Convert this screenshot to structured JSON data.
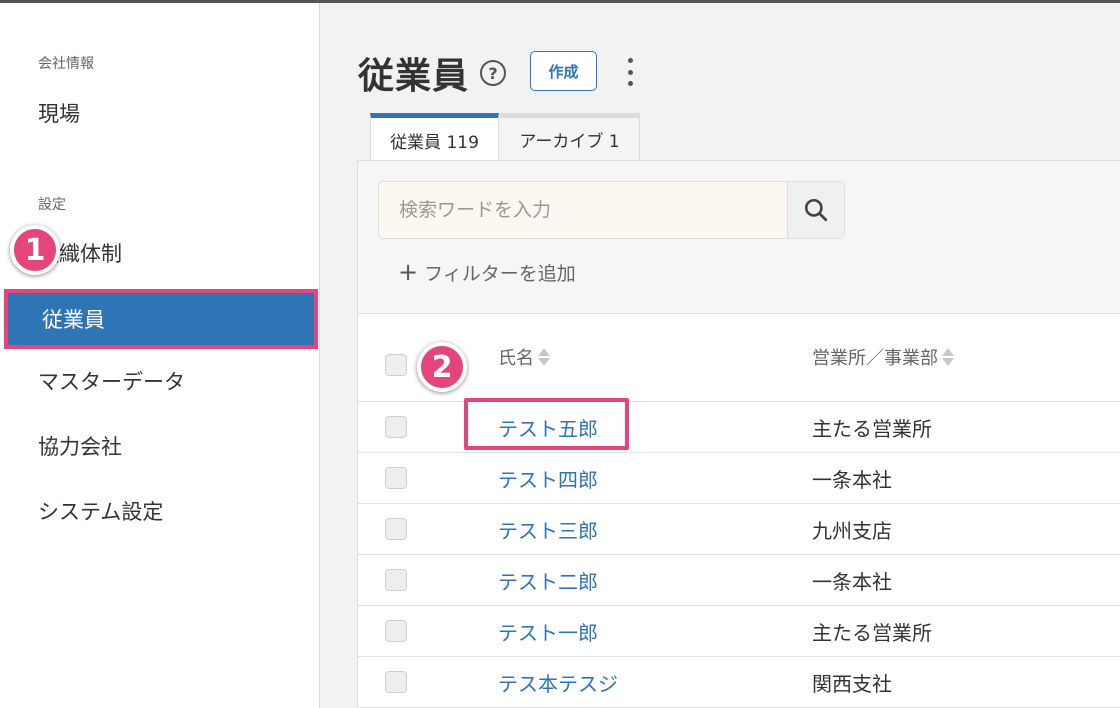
{
  "sidebar": {
    "section_company": "会社情報",
    "item_site": "現場",
    "section_settings": "設定",
    "item_org": "組織体制",
    "item_employees": "従業員",
    "item_master": "マスターデータ",
    "item_partners": "協力会社",
    "item_system": "システム設定"
  },
  "annotations": {
    "step1": "1",
    "step2": "2",
    "highlight_color": "#e4457a"
  },
  "header": {
    "title": "従業員",
    "help": "?",
    "create_label": "作成"
  },
  "tabs": [
    {
      "label": "従業員 119"
    },
    {
      "label": "アーカイブ 1"
    }
  ],
  "search": {
    "placeholder": "検索ワードを入力"
  },
  "filter": {
    "plus": "+",
    "label": "フィルターを追加"
  },
  "table": {
    "columns": [
      "氏名",
      "営業所／事業部"
    ],
    "rows": [
      {
        "name": "テスト五郎",
        "office": "主たる営業所"
      },
      {
        "name": "テスト四郎",
        "office": "一条本社"
      },
      {
        "name": "テスト三郎",
        "office": "九州支店"
      },
      {
        "name": "テスト二郎",
        "office": "一条本社"
      },
      {
        "name": "テスト一郎",
        "office": "主たる営業所"
      },
      {
        "name": "テス本テスジ",
        "office": "関西支社"
      }
    ]
  },
  "colors": {
    "accent": "#2f74b5",
    "highlight": "#e4457a"
  }
}
